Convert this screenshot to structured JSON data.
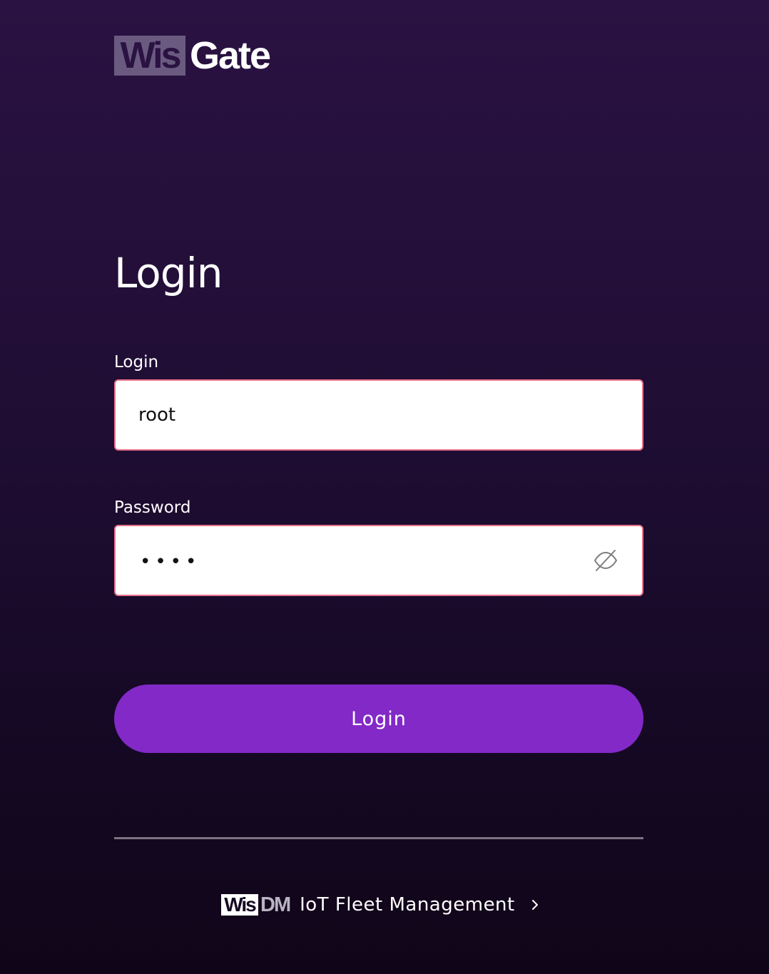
{
  "brand": {
    "logo_part1": "Wis",
    "logo_part2": "Gate"
  },
  "page": {
    "title": "Login"
  },
  "form": {
    "login_label": "Login",
    "login_value": "root",
    "password_label": "Password",
    "password_masked": "••••",
    "password_visibility_icon": "eye-off-icon",
    "submit_label": "Login"
  },
  "footer": {
    "wisdm_part1": "Wis",
    "wisdm_part2": "DM",
    "link_text": "IoT Fleet Management",
    "link_icon": "chevron-right-icon"
  },
  "colors": {
    "background_top": "#2a1242",
    "background_bottom": "#100518",
    "accent_button": "#8229c8",
    "input_border": "#e8728a",
    "logo_box": "#6b5a80",
    "divider": "#7a7484"
  }
}
